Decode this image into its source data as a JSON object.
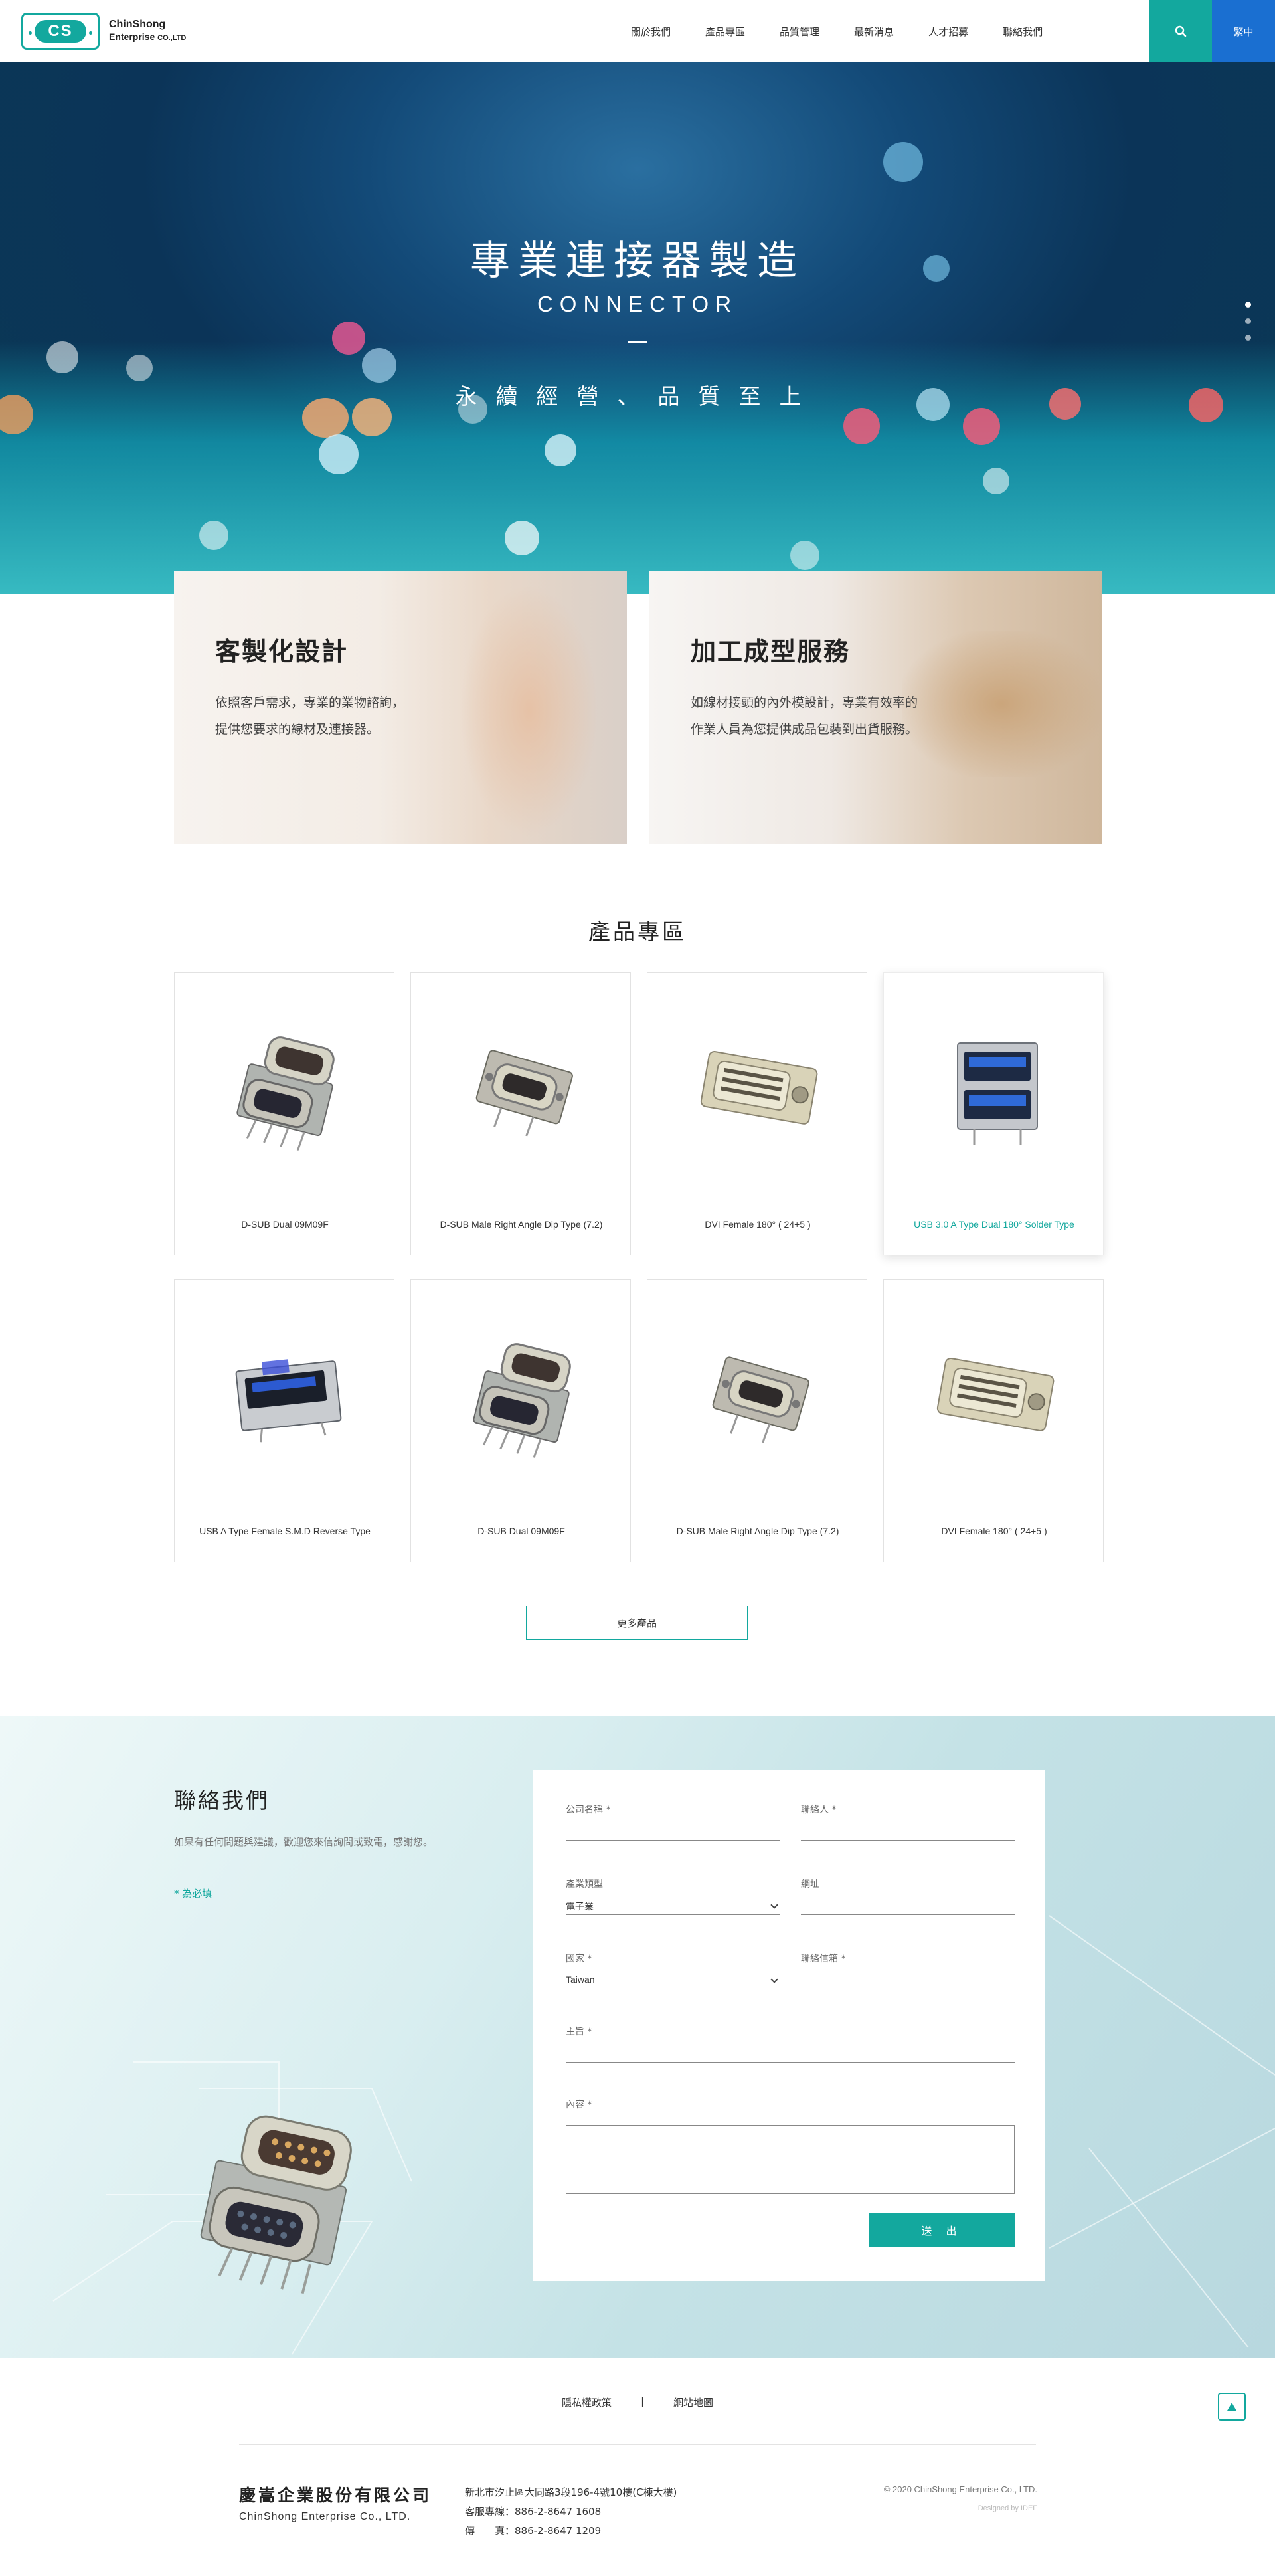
{
  "brand": {
    "badge": "CS",
    "name_line1": "ChinShong",
    "name_line2": "Enterprise",
    "name_suffix": "CO.,LTD"
  },
  "nav": {
    "items": [
      "關於我們",
      "產品專區",
      "品質管理",
      "最新消息",
      "人才招募",
      "聯絡我們"
    ],
    "search_icon": "search-icon",
    "lang": "繁中"
  },
  "hero": {
    "title": "專業連接器製造",
    "subtitle": "CONNECTOR",
    "tagline": "永續經營、品質至上",
    "slides": 3,
    "active_slide": 1
  },
  "services": [
    {
      "title": "客製化設計",
      "line1": "依照客戶需求，專業的業物諮詢，",
      "line2": "提供您要求的線材及連接器。"
    },
    {
      "title": "加工成型服務",
      "line1": "如線材接頭的內外模設計，專業有效率的",
      "line2": "作業人員為您提供成品包裝到出貨服務。"
    }
  ],
  "products": {
    "title": "產品專區",
    "items": [
      {
        "name": "D-SUB Dual 09M09F",
        "icon": "dsub-dual-icon"
      },
      {
        "name": "D-SUB Male Right Angle Dip Type (7.2)",
        "icon": "dsub-male-icon"
      },
      {
        "name": "DVI Female 180° ( 24+5 )",
        "icon": "dvi-female-icon"
      },
      {
        "name": "USB 3.0 A Type Dual 180° Solder Type",
        "icon": "usb-dual-icon"
      },
      {
        "name": "USB A Type Female S.M.D Reverse Type",
        "icon": "usb-female-icon"
      },
      {
        "name": "D-SUB Dual 09M09F",
        "icon": "dsub-dual-icon"
      },
      {
        "name": "D-SUB Male Right Angle Dip Type (7.2)",
        "icon": "dsub-male-icon"
      },
      {
        "name": "DVI Female 180° ( 24+5 )",
        "icon": "dvi-female-icon"
      }
    ],
    "more_label": "更多產品"
  },
  "contact": {
    "title": "聯絡我們",
    "desc": "如果有任何問題與建議，歡迎您來信詢問或致電，感謝您。",
    "required_note": "* 為必填",
    "fields": {
      "company": {
        "label": "公司名稱 *",
        "value": ""
      },
      "person": {
        "label": "聯絡人 *",
        "value": ""
      },
      "industry": {
        "label": "產業類型",
        "value": "電子業"
      },
      "website": {
        "label": "網址",
        "value": ""
      },
      "country": {
        "label": "國家 *",
        "value": "Taiwan"
      },
      "phone": {
        "label": "聯絡信箱 *",
        "value": ""
      },
      "subject": {
        "label": "主旨 *",
        "value": ""
      },
      "content": {
        "label": "內容 *",
        "value": ""
      }
    },
    "submit_label": "送 出"
  },
  "footer": {
    "links": [
      "隱私權政策",
      "|",
      "網站地圖"
    ],
    "company_zh": "慶嵩企業股份有限公司",
    "company_en": "ChinShong Enterprise Co., LTD.",
    "address": "新北市汐止區大同路3段196-4號10樓(C棟大樓)",
    "service_phone": "客服專線：886-2-8647 1608",
    "fax": "傳　　真：886-2-8647 1209",
    "copyright": "© 2020 ChinShong Enterprise Co., LTD.",
    "designed_by": "Designed by IDEF",
    "top_icon": "arrow-up-icon"
  },
  "colors": {
    "accent": "#13a89e",
    "lang_bg": "#1a6fd1"
  }
}
